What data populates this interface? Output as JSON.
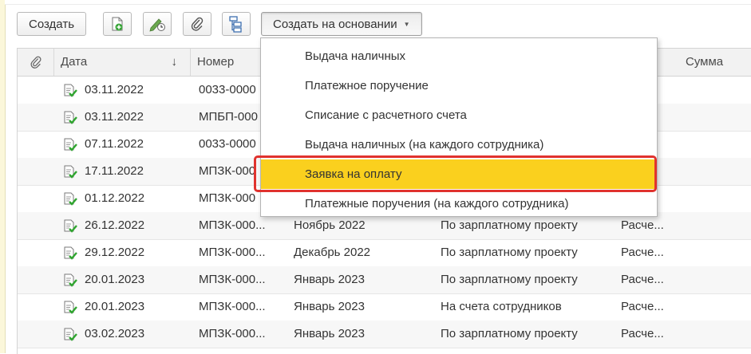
{
  "toolbar": {
    "create_label": "Создать",
    "create_based_on_label": "Создать на основании"
  },
  "table": {
    "headers": {
      "date": "Дата",
      "number": "Номер",
      "sum": "Сумма"
    },
    "rows": [
      {
        "date": "03.11.2022",
        "number": "0033-0000",
        "period": "",
        "type": "",
        "kind": ""
      },
      {
        "date": "03.11.2022",
        "number": "МПБП-000",
        "period": "",
        "type": "",
        "kind": ""
      },
      {
        "date": "07.11.2022",
        "number": "0033-0000",
        "period": "",
        "type": "",
        "kind": ""
      },
      {
        "date": "17.11.2022",
        "number": "МПЗК-000",
        "period": "",
        "type": "",
        "kind": ""
      },
      {
        "date": "01.12.2022",
        "number": "МПЗК-000",
        "period": "",
        "type": "",
        "kind": ""
      },
      {
        "date": "26.12.2022",
        "number": "МПЗК-000...",
        "period": "Ноябрь 2022",
        "type": "По зарплатному проекту",
        "kind": "Расче..."
      },
      {
        "date": "29.12.2022",
        "number": "МПЗК-000...",
        "period": "Декабрь 2022",
        "type": "По зарплатному проекту",
        "kind": "Расче..."
      },
      {
        "date": "20.01.2023",
        "number": "МПЗК-000...",
        "period": "Январь 2023",
        "type": "По зарплатному проекту",
        "kind": "Расче..."
      },
      {
        "date": "20.01.2023",
        "number": "МПЗК-000...",
        "period": "Январь 2023",
        "type": "На счета сотрудников",
        "kind": "Расче..."
      },
      {
        "date": "03.02.2023",
        "number": "МПЗК-000...",
        "period": "Январь 2023",
        "type": "По зарплатному проекту",
        "kind": "Расче..."
      }
    ]
  },
  "dropdown": {
    "items": [
      "Выдача наличных",
      "Платежное поручение",
      "Списание с расчетного счета",
      "Выдача наличных (на каждого сотрудника)",
      "Заявка на оплату",
      "Платежные поручения (на каждого сотрудника)"
    ],
    "active_index": 4
  },
  "colors": {
    "active_item": "#fad01e",
    "highlight_border": "#e0322e",
    "doc_icon_check": "#2fa52f"
  },
  "icons": {
    "toolbar": [
      "add-document-icon",
      "edit-date-icon",
      "paperclip-icon",
      "structure-icon"
    ],
    "row": "posted-document-icon",
    "header_clip": "paperclip-icon"
  }
}
